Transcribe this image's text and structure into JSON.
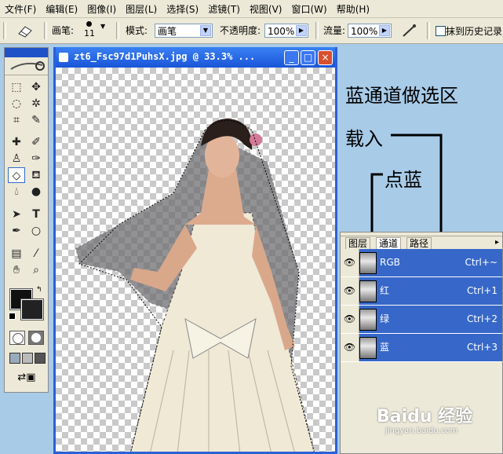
{
  "menu": [
    "文件(F)",
    "编辑(E)",
    "图像(I)",
    "图层(L)",
    "选择(S)",
    "滤镜(T)",
    "视图(V)",
    "窗口(W)",
    "帮助(H)"
  ],
  "options": {
    "brush_label": "画笔:",
    "brush_size": "11",
    "mode_label": "模式:",
    "mode_value": "画笔",
    "opacity_label": "不透明度:",
    "opacity_value": "100%",
    "flow_label": "流量:",
    "flow_value": "100%",
    "history_label": "抹到历史记录"
  },
  "document": {
    "title": "zt6_Fsc97d1PuhsX.jpg @ 33.3% ...",
    "min": "_",
    "max": "□",
    "close": "×"
  },
  "annotations": {
    "line1": "蓝通道做选区",
    "line2": "载入",
    "line3": "点蓝"
  },
  "channels_panel": {
    "tabs": [
      "图层",
      "通道",
      "路径"
    ],
    "rows": [
      {
        "name": "RGB",
        "shortcut": "Ctrl+~"
      },
      {
        "name": "红",
        "shortcut": "Ctrl+1"
      },
      {
        "name": "绿",
        "shortcut": "Ctrl+2"
      },
      {
        "name": "蓝",
        "shortcut": "Ctrl+3"
      }
    ]
  },
  "watermark": {
    "text": "Baidu 经验",
    "url": "jingyan.baidu.com"
  },
  "colors": {
    "accent": "#2b61d6",
    "channel_selected": "#3768c9",
    "desktop": "#a8cbe8"
  }
}
